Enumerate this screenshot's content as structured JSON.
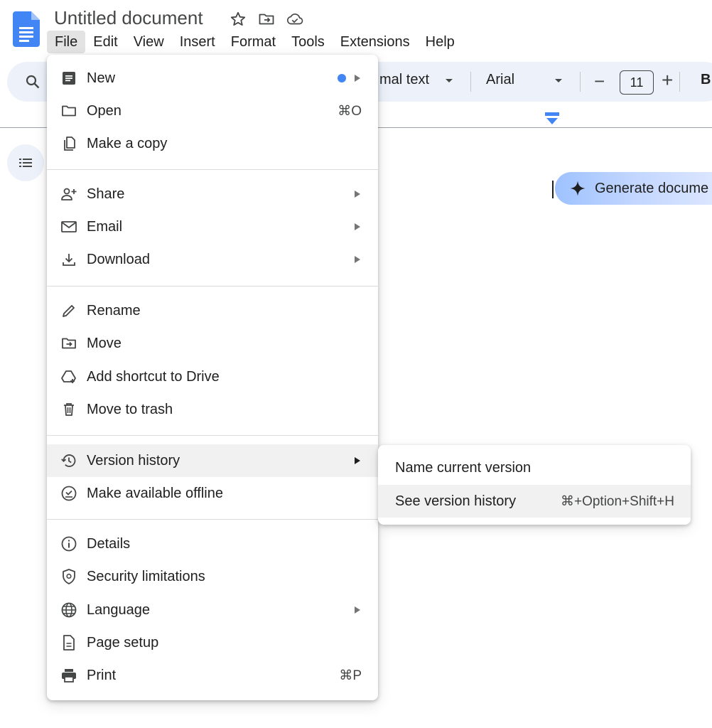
{
  "header": {
    "title": "Untitled document",
    "icons": [
      "star-icon",
      "move-folder-icon",
      "cloud-saved-icon"
    ]
  },
  "menubar": [
    "File",
    "Edit",
    "View",
    "Insert",
    "Format",
    "Tools",
    "Extensions",
    "Help"
  ],
  "toolbar": {
    "style_value": "mal text",
    "font_value": "Arial",
    "size_value": "11",
    "minus_label": "−",
    "plus_label": "+",
    "bold_label": "B"
  },
  "canvas": {
    "generate_label": "Generate docume"
  },
  "file_menu": {
    "items": [
      {
        "label": "New",
        "icon": "document-icon",
        "badge": true,
        "arrow": true
      },
      {
        "label": "Open",
        "icon": "folder-icon",
        "shortcut": "⌘O"
      },
      {
        "label": "Make a copy",
        "icon": "copy-icon"
      },
      {
        "label": "Share",
        "icon": "person-add-icon",
        "arrow": true
      },
      {
        "label": "Email",
        "icon": "mail-icon",
        "arrow": true
      },
      {
        "label": "Download",
        "icon": "download-icon",
        "arrow": true
      },
      {
        "label": "Rename",
        "icon": "pencil-icon"
      },
      {
        "label": "Move",
        "icon": "move-folder-icon"
      },
      {
        "label": "Add shortcut to Drive",
        "icon": "drive-shortcut-icon"
      },
      {
        "label": "Move to trash",
        "icon": "trash-icon"
      },
      {
        "label": "Version history",
        "icon": "history-icon",
        "arrow": true,
        "highlighted": true
      },
      {
        "label": "Make available offline",
        "icon": "offline-check-icon"
      },
      {
        "label": "Details",
        "icon": "info-icon"
      },
      {
        "label": "Security limitations",
        "icon": "shield-icon"
      },
      {
        "label": "Language",
        "icon": "globe-icon",
        "arrow": true
      },
      {
        "label": "Page setup",
        "icon": "page-icon"
      },
      {
        "label": "Print",
        "icon": "printer-icon",
        "shortcut": "⌘P"
      }
    ]
  },
  "submenu": {
    "items": [
      {
        "label": "Name current version"
      },
      {
        "label": "See version history",
        "shortcut": "⌘+Option+Shift+H",
        "highlighted": true
      }
    ]
  },
  "colors": {
    "accent": "#4285f4",
    "toolbar_bg": "#edf2fa",
    "highlight": "#f1f1f1",
    "text": "#1f1f1f"
  }
}
